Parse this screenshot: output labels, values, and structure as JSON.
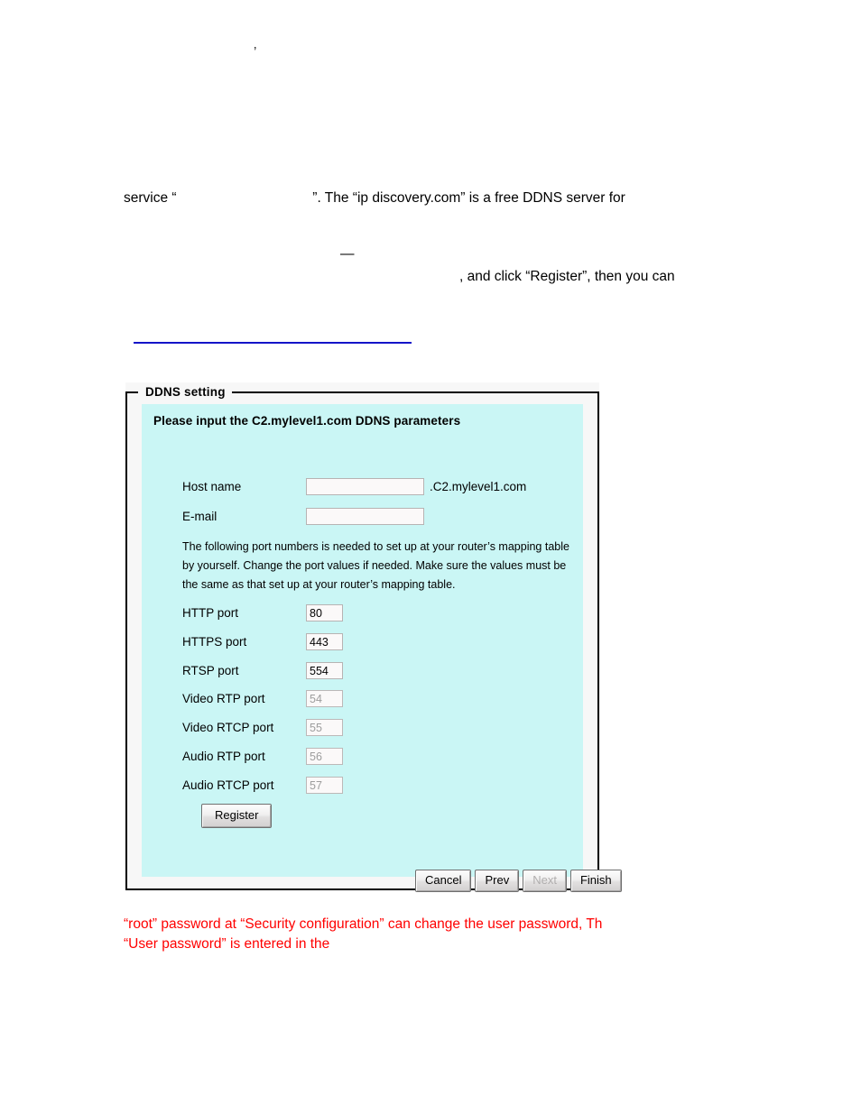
{
  "document": {
    "tiny_mark": "’",
    "paragraph_line_1": "service “                                   ”. The “ip discovery.com” is a free DDNS server for",
    "em_dash": "—",
    "paragraph_line_2": ", and click “Register”, then you can",
    "red_note": "“root” password at “Security configuration” can change the user password, Th\n“User password” is entered in the"
  },
  "panel": {
    "legend": "DDNS setting",
    "heading": "Please input the C2.mylevel1.com DDNS parameters",
    "note": "The following port numbers is needed to set up at your router’s mapping table by yourself. Change the port values if needed. Make sure the values must be the same as that set up at your router’s mapping table.",
    "fields": {
      "host_name": {
        "label": "Host name",
        "value": "",
        "suffix": ".C2.mylevel1.com"
      },
      "email": {
        "label": "E-mail",
        "value": ""
      },
      "http_port": {
        "label": "HTTP port",
        "value": "80",
        "disabled": false
      },
      "https_port": {
        "label": "HTTPS port",
        "value": "443",
        "disabled": false
      },
      "rtsp_port": {
        "label": "RTSP port",
        "value": "554",
        "disabled": false
      },
      "video_rtp_port": {
        "label": "Video RTP port",
        "value": "54",
        "disabled": true
      },
      "video_rtcp_port": {
        "label": "Video RTCP port",
        "value": "55",
        "disabled": true
      },
      "audio_rtp_port": {
        "label": "Audio RTP port",
        "value": "56",
        "disabled": true
      },
      "audio_rtcp_port": {
        "label": "Audio RTCP port",
        "value": "57",
        "disabled": true
      }
    },
    "buttons": {
      "register": "Register",
      "cancel": "Cancel",
      "prev": "Prev",
      "next": "Next",
      "finish": "Finish"
    }
  },
  "colors": {
    "panel_background": "#caf6f5",
    "panel_frame": "#f7f7f7",
    "border": "#000000",
    "rule": "#1414c8",
    "red_text": "#ff0000",
    "input_background": "#fbf9f9",
    "disabled_text": "#9d9d9d"
  }
}
